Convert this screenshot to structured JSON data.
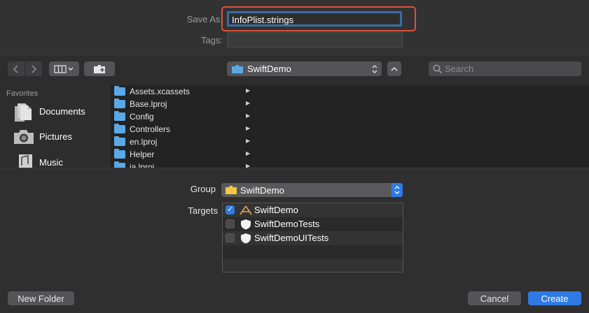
{
  "save_as": {
    "label": "Save As:",
    "value": "InfoPlist.strings"
  },
  "tags": {
    "label": "Tags:",
    "value": ""
  },
  "toolbar": {
    "location": "SwiftDemo",
    "search_placeholder": "Search"
  },
  "sidebar": {
    "heading": "Favorites",
    "items": [
      {
        "label": "Documents",
        "icon": "documents-icon"
      },
      {
        "label": "Pictures",
        "icon": "camera-icon"
      },
      {
        "label": "Music",
        "icon": "music-icon"
      }
    ]
  },
  "files": [
    {
      "name": "Assets.xcassets"
    },
    {
      "name": "Base.lproj"
    },
    {
      "name": "Config"
    },
    {
      "name": "Controllers"
    },
    {
      "name": "en.lproj"
    },
    {
      "name": "Helper"
    },
    {
      "name": "ja.lproj"
    }
  ],
  "group": {
    "label": "Group",
    "value": "SwiftDemo"
  },
  "targets": {
    "label": "Targets",
    "items": [
      {
        "name": "SwiftDemo",
        "checked": true,
        "icon": "app-icon"
      },
      {
        "name": "SwiftDemoTests",
        "checked": false,
        "icon": "shield-icon"
      },
      {
        "name": "SwiftDemoUITests",
        "checked": false,
        "icon": "shield-icon"
      }
    ]
  },
  "buttons": {
    "new_folder": "New Folder",
    "cancel": "Cancel",
    "create": "Create"
  },
  "colors": {
    "accent": "#2f7ae5",
    "highlight": "#e0513a",
    "folder": "#5aa9e6"
  }
}
